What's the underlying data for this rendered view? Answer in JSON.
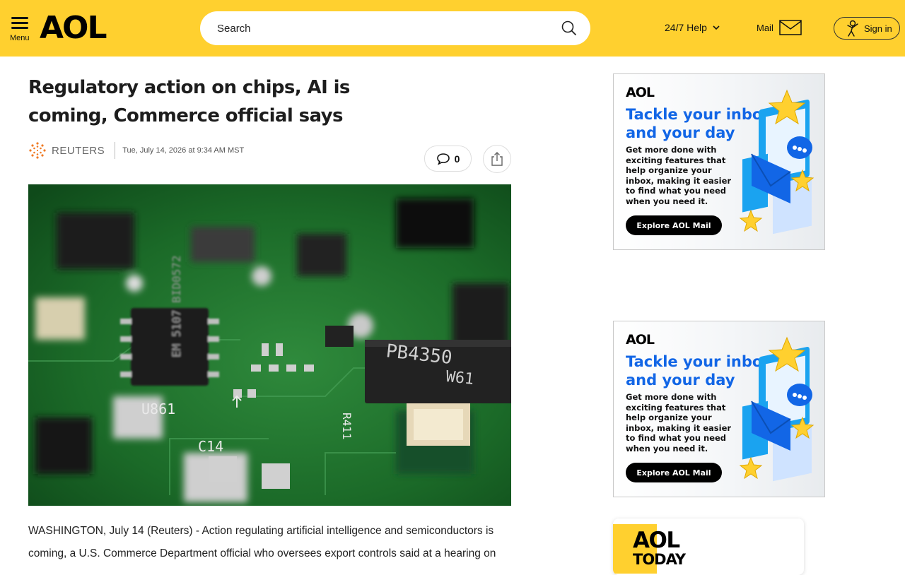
{
  "header": {
    "menu_label": "Menu",
    "logo_text": "AOL",
    "search_placeholder": "Search",
    "help_label": "24/7 Help",
    "mail_label": "Mail",
    "signin_label": "Sign in",
    "background_color": "#ffd02f"
  },
  "article": {
    "headline": "Regulatory action on chips, AI is coming, Commerce official says",
    "source": "REUTERS",
    "date": "Tue, July 14, 2026 at 9:34 AM MST",
    "comment_count": "0",
    "image_chip_labels": [
      "U861",
      "PB4350",
      "W61",
      "EM 5107 BID0572",
      "C14",
      "R411"
    ],
    "body_lead": "WASHINGTON, July 14 (Reuters) - Action regulating artificial intelligence and semiconductors is coming, a U.S. Commerce Department official who oversees export controls said at a hearing on"
  },
  "ads": [
    {
      "logo": "AOL",
      "title": "Tackle your inbox and your day",
      "body": "Get more done with exciting features that help organize your inbox, making it easier to find what you need when you need it.",
      "cta": "Explore AOL Mail"
    },
    {
      "logo": "AOL",
      "title": "Tackle your inbox and your day",
      "body": "Get more done with exciting features that help organize your inbox, making it easier to find what you need when you need it.",
      "cta": "Explore AOL Mail"
    }
  ],
  "today": {
    "line1": "AOL",
    "line2": "TODAY"
  },
  "icons": [
    "menu-icon",
    "search-icon",
    "chevron-down-icon",
    "mail-icon",
    "signin-person-icon",
    "reuters-logo-icon",
    "comment-icon",
    "share-icon",
    "star-icon",
    "envelope-icon"
  ]
}
